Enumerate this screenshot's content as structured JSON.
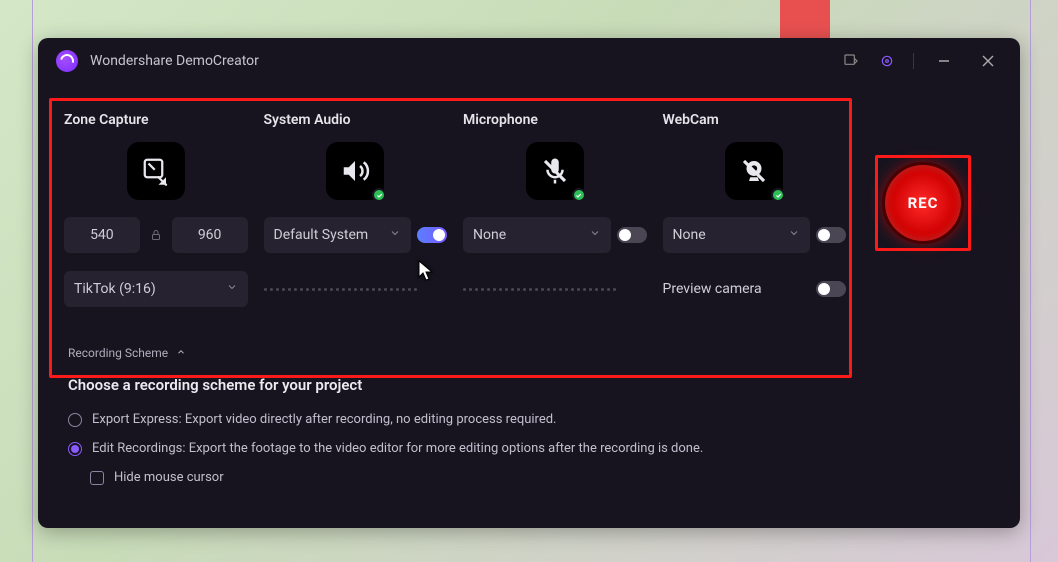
{
  "app": {
    "title": "Wondershare DemoCreator"
  },
  "panels": {
    "zone": {
      "title": "Zone Capture",
      "width": "540",
      "height": "960",
      "preset": "TikTok (9:16)"
    },
    "system": {
      "title": "System Audio",
      "device": "Default System",
      "enabled": true
    },
    "mic": {
      "title": "Microphone",
      "device": "None",
      "enabled": false
    },
    "cam": {
      "title": "WebCam",
      "device": "None",
      "enabled": false,
      "preview_label": "Preview camera",
      "preview_enabled": false
    }
  },
  "record": {
    "label": "REC"
  },
  "scheme": {
    "heading": "Recording Scheme",
    "subtitle": "Choose a recording scheme for your project",
    "options": [
      {
        "label": "Export Express: Export video directly after recording, no editing process required.",
        "selected": false
      },
      {
        "label": "Edit Recordings: Export the footage to the video editor for more editing options after the recording is done.",
        "selected": true
      }
    ],
    "hide_cursor_label": "Hide mouse cursor"
  }
}
